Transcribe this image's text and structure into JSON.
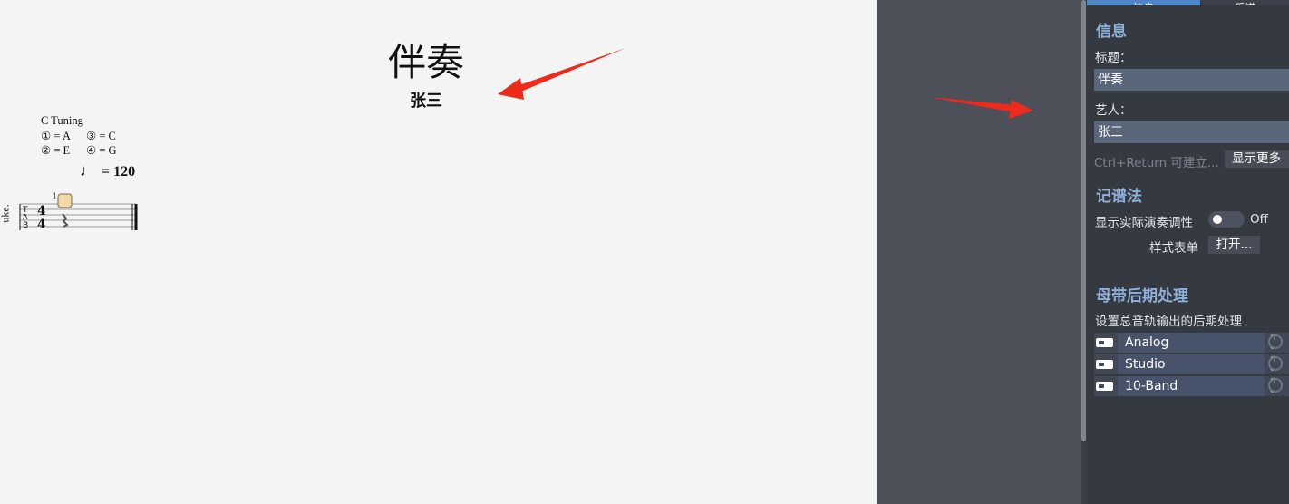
{
  "score": {
    "title": "伴奏",
    "artist": "张三",
    "tuning": {
      "title": "C Tuning",
      "rows": [
        [
          "① = A",
          "③ = C"
        ],
        [
          "② = E",
          "④ = G"
        ]
      ]
    },
    "tempo": {
      "note_icon": "quarter-note-icon",
      "value": "= 120"
    },
    "staff": {
      "label": "uke.",
      "tab_letters": [
        "T",
        "A",
        "B"
      ],
      "time_signature": "4/4",
      "measure_number": "1"
    }
  },
  "panel": {
    "tabs": [
      "信息",
      "乐谱"
    ],
    "info": {
      "heading": "信息",
      "title_label": "标题：",
      "title_value": "伴奏",
      "artist_label": "艺人：",
      "artist_value": "张三",
      "hint": "Ctrl+Return 可建立...",
      "show_more": "显示更多"
    },
    "notation": {
      "heading": "记谱法",
      "concert_pitch_label": "显示实际演奏调性",
      "concert_pitch_state": "Off",
      "stylesheet_label": "样式表单",
      "stylesheet_button": "打开..."
    },
    "mastering": {
      "heading": "母带后期处理",
      "description": "设置总音轨输出的后期处理",
      "effects": [
        {
          "name": "Analog",
          "icon": "effect-preset-icon"
        },
        {
          "name": "Studio",
          "icon": "effect-preset-icon"
        },
        {
          "name": "10-Band",
          "icon": "effect-preset-icon"
        }
      ]
    }
  },
  "colors": {
    "accent_tab": "#4f86c7",
    "section_title": "#8fb0d9",
    "annotation_arrow": "#ee2a1b"
  }
}
